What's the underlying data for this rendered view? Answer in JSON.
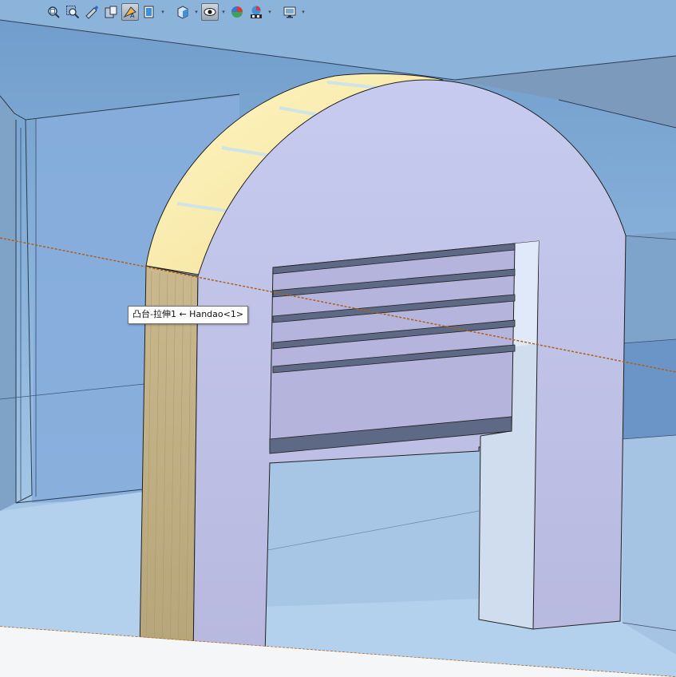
{
  "toolbar": {
    "buttons": [
      {
        "icon": "zoom-to-fit-icon",
        "active": false
      },
      {
        "icon": "zoom-to-area-icon",
        "active": false
      },
      {
        "icon": "previous-view-icon",
        "active": false
      },
      {
        "icon": "section-view-icon",
        "active": false
      },
      {
        "icon": "dynamic-annotation-view-icon",
        "active": true
      },
      {
        "icon": "view-orientation-icon",
        "active": false
      },
      {
        "icon": "display-style-icon",
        "active": false
      },
      {
        "icon": "hide-show-items-icon",
        "active": true
      },
      {
        "icon": "edit-appearance-icon",
        "active": false
      },
      {
        "icon": "apply-scene-icon",
        "active": false
      },
      {
        "icon": "view-settings-icon",
        "active": false
      }
    ]
  },
  "colors": {
    "background_top": "#7fa7cf",
    "background_bottom": "#b7d3ec",
    "part_face_front": "#c3c6e8",
    "part_face_side": "#f6eea6",
    "selected_edge": "#ffeeb0",
    "plane_line": "#b0601a"
  },
  "tooltip": {
    "text": "凸台-拉伸1 ← Handao<1>"
  }
}
